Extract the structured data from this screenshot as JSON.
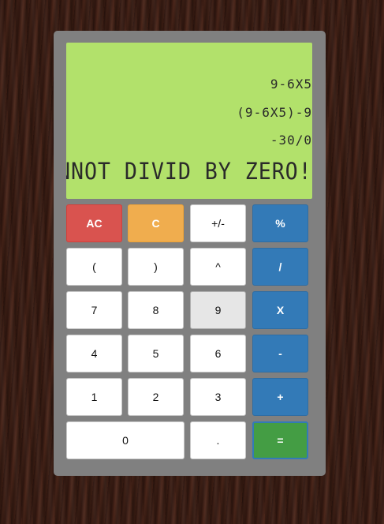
{
  "display": {
    "history": [
      "9-6X5",
      "(9-6X5)-9",
      "-30/0"
    ],
    "result": "CANNOT DIVID BY ZERO!"
  },
  "keys": {
    "ac": "AC",
    "c": "C",
    "negate": "+/-",
    "percent": "%",
    "lparen": "(",
    "rparen": ")",
    "power": "^",
    "divide": "/",
    "seven": "7",
    "eight": "8",
    "nine": "9",
    "multiply": "X",
    "four": "4",
    "five": "5",
    "six": "6",
    "minus": "-",
    "one": "1",
    "two": "2",
    "three": "3",
    "plus": "+",
    "zero": "0",
    "dot": ".",
    "equals": "="
  },
  "colors": {
    "display_bg": "#b2e16b",
    "clear_all": "#d9534f",
    "clear": "#f0ad4e",
    "operator": "#337ab7",
    "equals": "#449d44",
    "body": "#808080"
  }
}
